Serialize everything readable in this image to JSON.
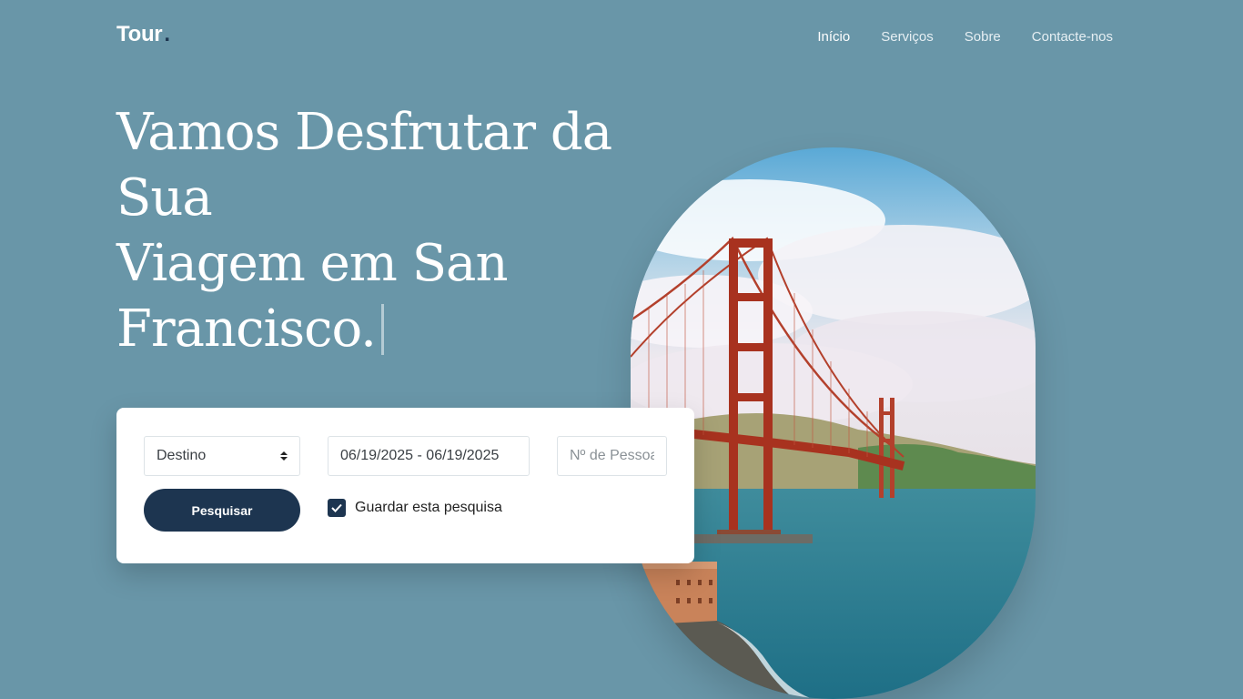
{
  "header": {
    "logo_text": "Tour",
    "logo_dot": ".",
    "nav": [
      {
        "label": "Início",
        "active": true
      },
      {
        "label": "Serviços",
        "active": false
      },
      {
        "label": "Sobre",
        "active": false
      },
      {
        "label": "Contacte-nos",
        "active": false
      }
    ]
  },
  "hero": {
    "title_lines": [
      "Vamos Desfrutar da",
      "Sua",
      "Viagem em San",
      "Francisco."
    ]
  },
  "search": {
    "destination_value": "Destino",
    "date_range_value": "06/19/2025 - 06/19/2025",
    "people_placeholder": "Nº de Pessoas",
    "search_button_label": "Pesquisar",
    "save_search_label": "Guardar esta pesquisa",
    "save_search_checked": true
  },
  "colors": {
    "background": "#6996a8",
    "accent": "#1d3550"
  },
  "icons": {
    "select_arrows": "chevron-updown-icon",
    "checkbox": "check-icon"
  }
}
